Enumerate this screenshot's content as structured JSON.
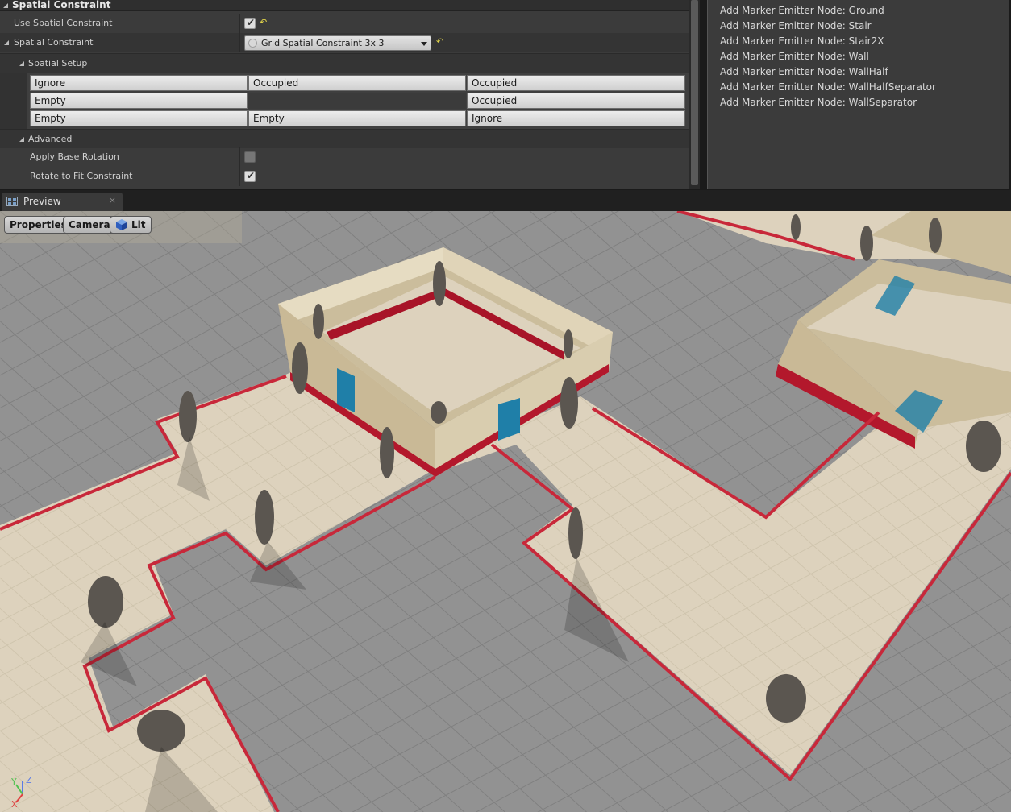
{
  "details": {
    "category_title": "Spatial Constraint",
    "use_spatial_constraint": {
      "label": "Use Spatial Constraint",
      "checked": true
    },
    "spatial_constraint": {
      "label": "Spatial Constraint",
      "value": "Grid Spatial Constraint 3x 3"
    },
    "spatial_setup": {
      "label": "Spatial Setup",
      "grid": [
        [
          "Ignore",
          "Occupied",
          "Occupied"
        ],
        [
          "Empty",
          "",
          "Occupied"
        ],
        [
          "Empty",
          "Empty",
          "Ignore"
        ]
      ]
    },
    "advanced": {
      "label": "Advanced",
      "apply_base_rotation": {
        "label": "Apply Base Rotation",
        "checked": false
      },
      "rotate_to_fit": {
        "label": "Rotate to Fit Constraint",
        "checked": true
      }
    },
    "reset_glyph": "↶",
    "check_glyph": "✔"
  },
  "markers": {
    "items": [
      "Add Marker Emitter Node: Ground",
      "Add Marker Emitter Node: Stair",
      "Add Marker Emitter Node: Stair2X",
      "Add Marker Emitter Node: Wall",
      "Add Marker Emitter Node: WallHalf",
      "Add Marker Emitter Node: WallHalfSeparator",
      "Add Marker Emitter Node: WallSeparator"
    ]
  },
  "preview_tab": {
    "title": "Preview",
    "close": "×"
  },
  "viewport": {
    "buttons": {
      "properties": "Properties",
      "camera": "Camera",
      "lit": "Lit"
    },
    "axes": {
      "x": "X",
      "y": "Y",
      "z": "Z"
    }
  },
  "colors": {
    "rail": "#c8283a",
    "floor": "#ddd2bd",
    "wall": "#cfc1a0",
    "door": "#1f7fa8",
    "ground": "#909090"
  }
}
